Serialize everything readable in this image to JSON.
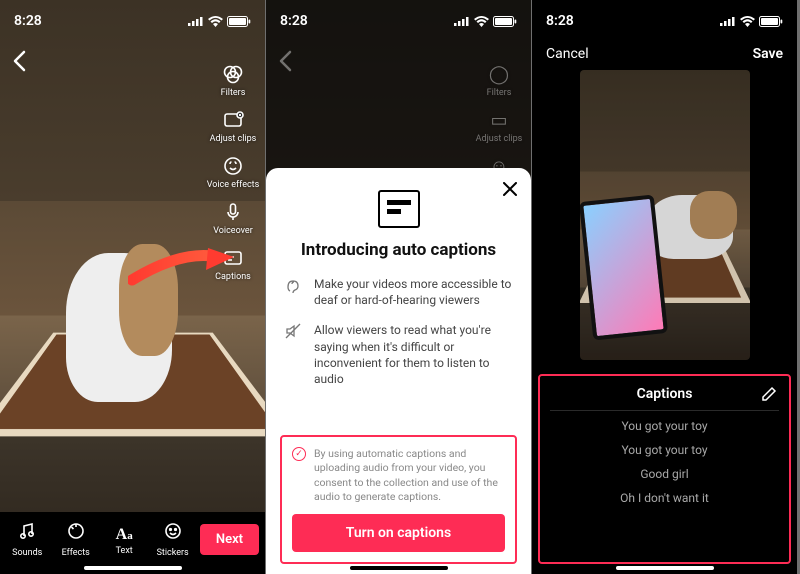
{
  "status_time": "8:28",
  "colors": {
    "accent": "#fe2c55"
  },
  "phone1": {
    "back_icon": "chevron-left",
    "tools": [
      {
        "label": "Filters",
        "icon": "filters"
      },
      {
        "label": "Adjust clips",
        "icon": "adjust-clips"
      },
      {
        "label": "Voice effects",
        "icon": "voice-effects"
      },
      {
        "label": "Voiceover",
        "icon": "voiceover"
      },
      {
        "label": "Captions",
        "icon": "captions"
      }
    ],
    "bottom": [
      {
        "label": "Sounds",
        "icon": "sounds"
      },
      {
        "label": "Effects",
        "icon": "effects"
      },
      {
        "label": "Text",
        "icon": "text"
      },
      {
        "label": "Stickers",
        "icon": "stickers"
      }
    ],
    "next_label": "Next"
  },
  "phone2": {
    "modal": {
      "close_icon": "close",
      "title": "Introducing auto captions",
      "points": [
        {
          "icon": "ear",
          "text": "Make your videos more accessible to deaf or hard-of-hearing viewers"
        },
        {
          "icon": "no-audio",
          "text": "Allow viewers to read what you're saying when it's difficult or inconvenient for them to listen to audio"
        }
      ],
      "consent_text": "By using automatic captions and uploading audio from your video, you consent to the collection and use of the audio to generate captions.",
      "turn_on_label": "Turn on captions"
    }
  },
  "phone3": {
    "header": {
      "cancel": "Cancel",
      "save": "Save"
    },
    "captions": {
      "title": "Captions",
      "edit_icon": "pencil",
      "items": [
        "You got your toy",
        "You got your toy",
        "Good girl",
        "Oh I don't want it"
      ]
    }
  }
}
